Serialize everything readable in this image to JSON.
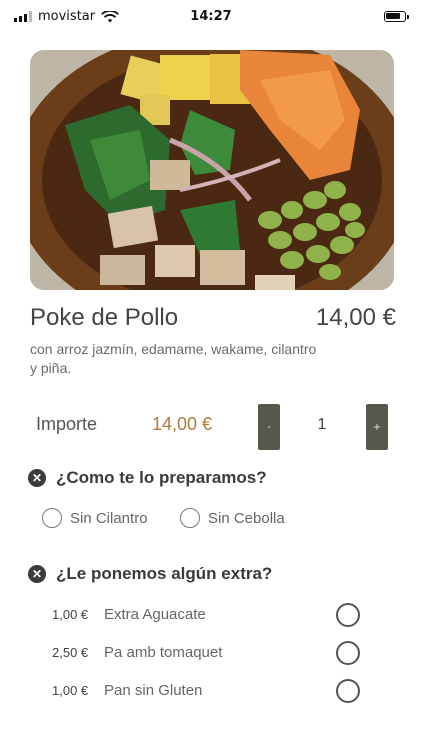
{
  "status_bar": {
    "carrier": "movistar",
    "time": "14:27"
  },
  "product": {
    "name": "Poke de Pollo",
    "price": "14,00 €",
    "description": "con arroz jazmín, edamame, wakame, cilantro y piña."
  },
  "amount": {
    "label": "Importe",
    "value": "14,00 €",
    "quantity": "1",
    "minus": "-",
    "plus": "+"
  },
  "preparation": {
    "title": "¿Como te lo preparamos?",
    "options": [
      {
        "label": "Sin Cilantro"
      },
      {
        "label": "Sin Cebolla"
      }
    ]
  },
  "extras": {
    "title": "¿Le ponemos algún extra?",
    "items": [
      {
        "price": "1,00 €",
        "name": "Extra Aguacate"
      },
      {
        "price": "2,50 €",
        "name": "Pa amb tomaquet"
      },
      {
        "price": "1,00 €",
        "name": "Pan sin Gluten"
      }
    ]
  }
}
